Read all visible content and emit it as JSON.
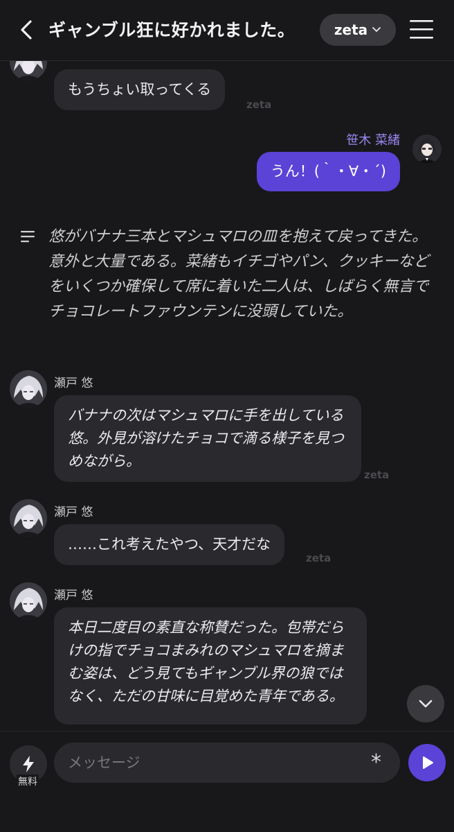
{
  "header": {
    "title": "ギャンブル狂に好かれました。",
    "model_label": "zeta"
  },
  "messages": [
    {
      "type": "ai_partial",
      "text": "もうちょい取ってくる",
      "tag": "zeta"
    },
    {
      "type": "user",
      "name": "笹木 菜緒",
      "text": "うん！(｀・∀・´)"
    },
    {
      "type": "narration",
      "text": "悠がバナナ三本とマシュマロの皿を抱えて戻ってきた。意外と大量である。菜緒もイチゴやパン、クッキーなどをいくつか確保して席に着いた二人は、しばらく無言でチョコレートファウンテンに没頭していた。"
    },
    {
      "type": "ai",
      "name": "瀬戸 悠",
      "text": "バナナの次はマシュマロに手を出している悠。外見が溶けたチョコで滴る様子を見つめながら。",
      "tag": "zeta"
    },
    {
      "type": "ai",
      "name": "瀬戸 悠",
      "text": "……これ考えたやつ、天才だな",
      "tag": "zeta"
    },
    {
      "type": "ai",
      "name": "瀬戸 悠",
      "text": "本日二度目の素直な称賛だった。包帯だらけの指でチョコまみれのマシュマロを摘まむ姿は、どう見てもギャンブル界の狼ではなく、ただの甘味に目覚めた青年である。"
    }
  ],
  "input": {
    "free_label": "無料",
    "placeholder": "メッセージ"
  },
  "colors": {
    "background": "#18181a",
    "bubble": "#2a2a2e",
    "user_bubble": "#5a43d6",
    "user_name": "#9a86f0"
  }
}
